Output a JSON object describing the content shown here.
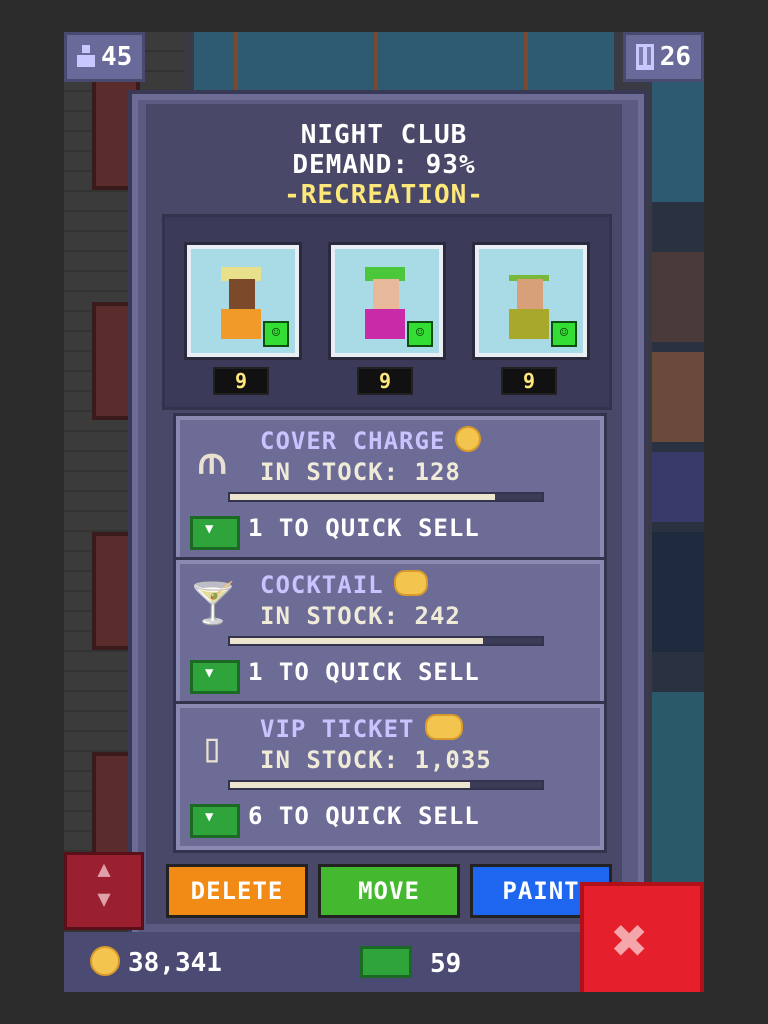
{
  "top": {
    "population": "45",
    "floors": "26"
  },
  "header": {
    "name": "NIGHT CLUB",
    "demand": "DEMAND: 93%",
    "category": "-RECREATION-"
  },
  "staff": [
    {
      "level": "9",
      "happy": "☺"
    },
    {
      "level": "9",
      "happy": "☺"
    },
    {
      "level": "9",
      "happy": "☺"
    }
  ],
  "items": [
    {
      "name": "COVER CHARGE",
      "stock": "IN STOCK: 128",
      "stock_fraction": 0.85,
      "quick_sell": "1 TO QUICK SELL",
      "icon": "rope-barrier-icon"
    },
    {
      "name": "COCKTAIL",
      "stock": "IN STOCK: 242",
      "stock_fraction": 0.81,
      "quick_sell": "1 TO QUICK SELL",
      "icon": "cocktail-glass-icon"
    },
    {
      "name": "VIP TICKET",
      "stock": "IN STOCK: 1,035",
      "stock_fraction": 0.77,
      "quick_sell": "6 TO QUICK SELL",
      "icon": "ticket-icon"
    }
  ],
  "buttons": {
    "delete": "DELETE",
    "move": "MOVE",
    "paint": "PAINT"
  },
  "bottom": {
    "coins": "38,341",
    "bux": "59"
  },
  "colors": {
    "delete": "#f28a16",
    "move": "#44b82e",
    "paint": "#1e66f0",
    "close": "#e5202c",
    "category": "#ffe87a"
  }
}
